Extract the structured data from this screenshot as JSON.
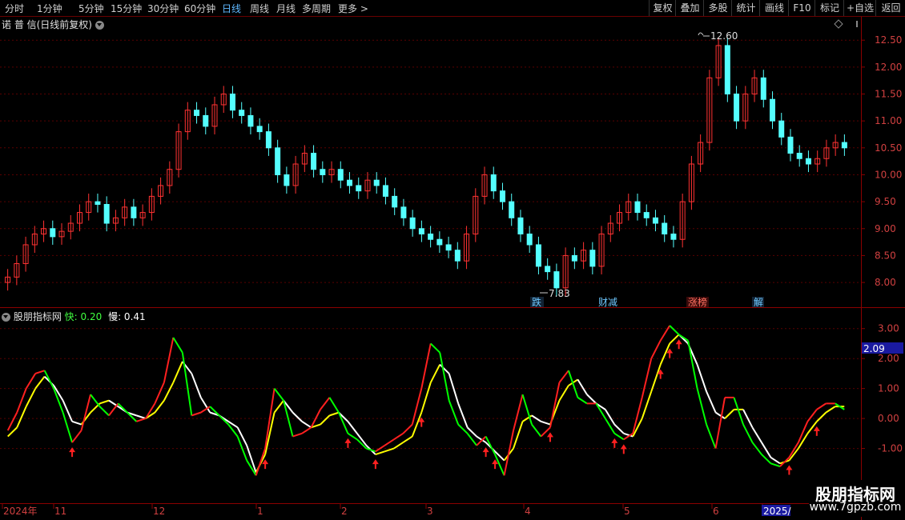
{
  "toolbar": {
    "periods": [
      "分时",
      "1分钟",
      "5分钟",
      "15分钟",
      "30分钟",
      "60分钟",
      "日线",
      "周线",
      "月线",
      "多周期",
      "更多"
    ],
    "active_period": "日线",
    "right_buttons": [
      "复权",
      "叠加",
      "多股",
      "统计",
      "画线",
      "F10",
      "标记",
      "+自选",
      "返回"
    ]
  },
  "stock": {
    "title": "诺 普 信(日线前复权)"
  },
  "price_axis": {
    "labels": [
      "12.50",
      "12.00",
      "11.50",
      "11.00",
      "10.50",
      "10.00",
      "9.50",
      "9.00",
      "8.50",
      "8.00"
    ]
  },
  "price_annotations": {
    "high": "12.60",
    "low": "7.83"
  },
  "badges": [
    {
      "text": "跌",
      "color": "#6ec8ff"
    },
    {
      "text": "财减",
      "color": "#6ec8ff"
    },
    {
      "text": "涨榜",
      "color": "#ff6060"
    },
    {
      "text": "解",
      "color": "#6ec8ff"
    }
  ],
  "indicator": {
    "name": "股朋指标网",
    "fast_label": "快: 0.20",
    "slow_label": "慢: 0.41",
    "axis_labels": [
      "3.00",
      "2.00",
      "1.00",
      "0.00",
      "-1.00"
    ],
    "current_value": "2.09"
  },
  "time_axis": {
    "labels": [
      "2024年",
      "11",
      "12",
      "1",
      "2",
      "3",
      "4",
      "5",
      "6",
      "2025/"
    ]
  },
  "watermark": {
    "line1": "股朋指标网",
    "line2": "www.7gpzb.com"
  },
  "colors": {
    "up": "#ff3232",
    "down": "#54ffff",
    "grid": "#5a0000",
    "fast_rise": "#ff2020",
    "fast_fall": "#00ff00",
    "slow_rise": "#ffff00",
    "slow_fall": "#ffffff"
  },
  "chart_data": {
    "type": "line",
    "price_series": [
      8.1,
      8.35,
      8.7,
      8.9,
      9.0,
      8.85,
      8.95,
      9.1,
      9.3,
      9.5,
      9.45,
      9.1,
      9.2,
      9.4,
      9.2,
      9.3,
      9.6,
      9.8,
      10.1,
      10.8,
      11.2,
      11.1,
      10.9,
      11.3,
      11.5,
      11.2,
      11.1,
      10.9,
      10.8,
      10.5,
      10.0,
      9.8,
      10.2,
      10.4,
      10.1,
      10.0,
      10.1,
      9.9,
      9.8,
      9.7,
      9.9,
      9.8,
      9.6,
      9.4,
      9.2,
      9.0,
      8.9,
      8.8,
      8.7,
      8.6,
      8.4,
      8.9,
      9.6,
      10.0,
      9.7,
      9.5,
      9.2,
      8.9,
      8.7,
      8.3,
      8.2,
      7.9,
      8.5,
      8.4,
      8.6,
      8.3,
      8.9,
      9.1,
      9.3,
      9.5,
      9.3,
      9.2,
      9.1,
      8.9,
      8.8,
      9.5,
      10.2,
      10.6,
      11.8,
      12.4,
      11.5,
      11.0,
      11.5,
      11.8,
      11.4,
      11.0,
      10.7,
      10.4,
      10.3,
      10.2,
      10.3,
      10.5,
      10.6,
      10.5
    ],
    "fast_series": [
      -0.4,
      0.2,
      1.0,
      1.5,
      1.6,
      1.0,
      0.2,
      -0.8,
      -0.4,
      0.8,
      0.4,
      0.1,
      0.5,
      0.2,
      -0.1,
      0.0,
      0.5,
      1.2,
      2.7,
      2.2,
      0.1,
      0.2,
      0.4,
      0.1,
      -0.2,
      -0.6,
      -1.4,
      -1.9,
      -1.0,
      1.0,
      0.6,
      -0.6,
      -0.5,
      -0.3,
      0.3,
      0.7,
      0.2,
      -0.5,
      -0.7,
      -1.0,
      -1.1,
      -0.9,
      -0.7,
      -0.5,
      -0.2,
      1.0,
      2.5,
      2.2,
      0.6,
      -0.2,
      -0.5,
      -0.9,
      -0.6,
      -1.2,
      -1.9,
      -0.4,
      0.8,
      -0.2,
      -0.6,
      -0.3,
      1.2,
      1.6,
      0.7,
      0.5,
      0.5,
      0.0,
      -0.5,
      -0.7,
      -0.5,
      0.7,
      2.0,
      2.6,
      3.1,
      2.8,
      2.6,
      1.0,
      -0.2,
      -1.0,
      0.7,
      0.7,
      -0.2,
      -0.8,
      -1.2,
      -1.5,
      -1.6,
      -1.3,
      -0.8,
      -0.1,
      0.3,
      0.5,
      0.5,
      0.3
    ],
    "slow_series": [
      -0.6,
      -0.3,
      0.4,
      1.0,
      1.4,
      1.1,
      0.6,
      -0.1,
      -0.2,
      0.2,
      0.5,
      0.6,
      0.4,
      0.2,
      0.1,
      0.0,
      0.2,
      0.6,
      1.2,
      1.9,
      1.5,
      0.7,
      0.2,
      0.1,
      -0.1,
      -0.3,
      -0.9,
      -1.8,
      -1.2,
      0.2,
      0.6,
      0.2,
      -0.1,
      -0.3,
      -0.2,
      0.1,
      0.2,
      -0.1,
      -0.5,
      -0.9,
      -1.2,
      -1.1,
      -1.0,
      -0.8,
      -0.6,
      0.2,
      1.2,
      1.8,
      1.5,
      0.5,
      -0.3,
      -0.6,
      -0.8,
      -1.1,
      -1.4,
      -1.0,
      -0.1,
      0.1,
      -0.1,
      -0.2,
      0.6,
      1.1,
      1.3,
      0.8,
      0.5,
      0.3,
      -0.2,
      -0.5,
      -0.6,
      0.0,
      0.9,
      1.8,
      2.5,
      2.8,
      2.5,
      1.8,
      0.9,
      0.2,
      0.0,
      0.3,
      0.3,
      -0.3,
      -0.8,
      -1.3,
      -1.5,
      -1.4,
      -1.0,
      -0.5,
      -0.1,
      0.2,
      0.4,
      0.4
    ],
    "buy_signal_indices": [
      7,
      28,
      37,
      40,
      45,
      52,
      53,
      59,
      66,
      67,
      71,
      72,
      73,
      85,
      88
    ],
    "price_range": [
      7.6,
      12.8
    ],
    "indicator_range": [
      -2.8,
      3.5
    ]
  }
}
